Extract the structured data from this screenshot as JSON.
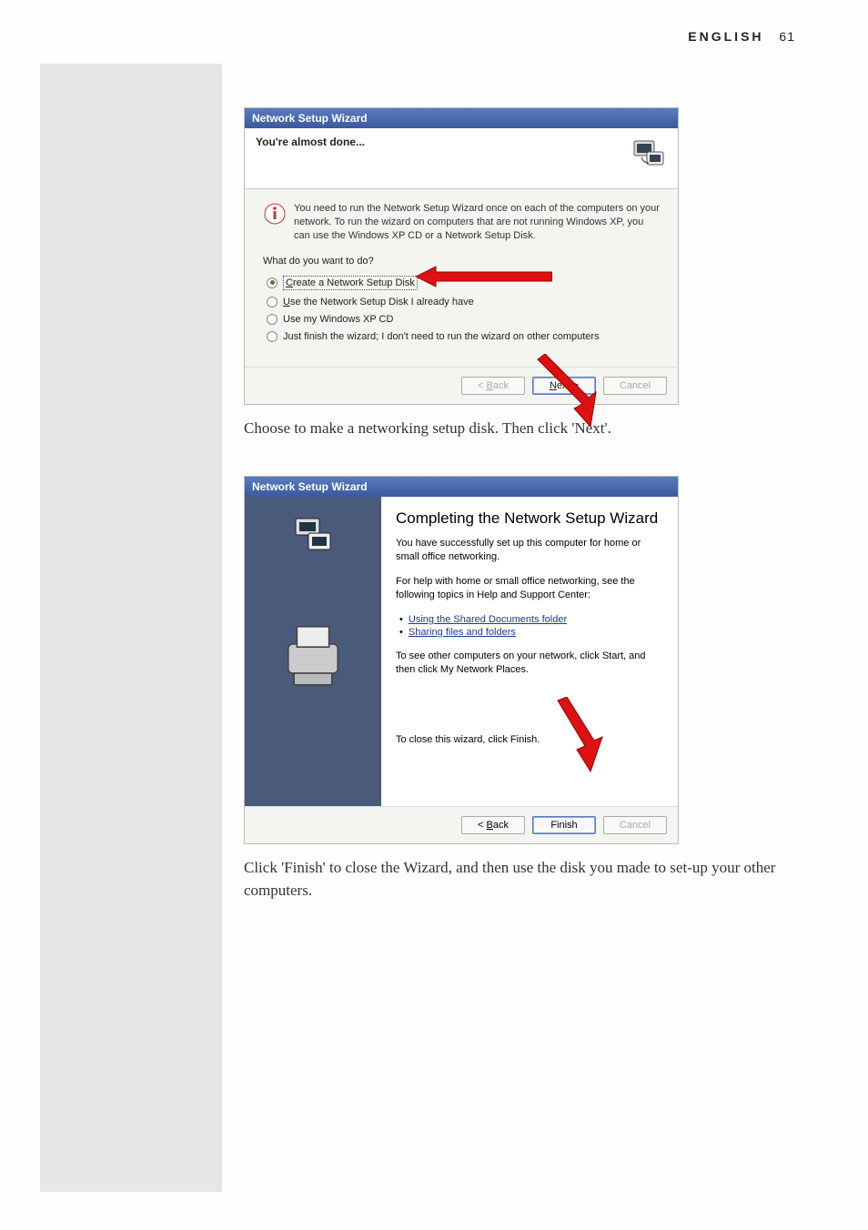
{
  "header": {
    "language": "ENGLISH",
    "page_number": "61"
  },
  "dialog1": {
    "window_title": "Network Setup Wizard",
    "header_title": "You're almost done...",
    "info_text": "You need to run the Network Setup Wizard once on each of the computers on your network. To run the wizard on computers that are not running Windows XP, you can use the Windows XP CD or a Network Setup Disk.",
    "prompt": "What do you want to do?",
    "options": {
      "o1_prefix": "C",
      "o1_rest": "reate a Network Setup Disk",
      "o2_prefix": "U",
      "o2_rest": "se the Network Setup Disk I already have",
      "o3_text": "Use my Windows XP CD",
      "o4_text": "Just finish the wizard; I don't need to run the wizard on other computers"
    },
    "buttons": {
      "back_prefix": "< ",
      "back_u": "B",
      "back_rest": "ack",
      "next_u": "N",
      "next_rest": "ext >",
      "cancel": "Cancel"
    }
  },
  "caption1": "Choose to make a networking setup disk. Then click 'Next'.",
  "dialog2": {
    "window_title": "Network Setup Wizard",
    "title": "Completing the Network Setup Wizard",
    "p1": "You have successfully set up this computer for home or small office networking.",
    "p2": "For help with home or small office networking, see the following topics in Help and Support Center:",
    "link1_u": "U",
    "link1_rest": "sing the Shared Documents folder",
    "link2_u": "S",
    "link2_rest": "haring files and folders",
    "p3": "To see other computers on your network, click Start, and then click My Network Places.",
    "p4": "To close this wizard, click Finish.",
    "buttons": {
      "back_prefix": "< ",
      "back_u": "B",
      "back_rest": "ack",
      "finish": "Finish",
      "cancel": "Cancel"
    }
  },
  "caption2": "Click 'Finish' to close the Wizard, and then use the disk you made to set-up your other computers."
}
